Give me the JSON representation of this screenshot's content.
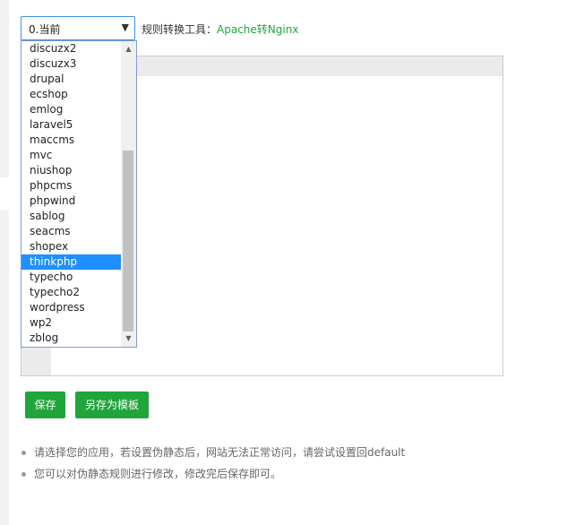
{
  "select": {
    "value": "0.当前"
  },
  "tool": {
    "label": "规则转换工具：",
    "link": "Apache转Nginx"
  },
  "dropdown": {
    "options": [
      "discuzx2",
      "discuzx3",
      "drupal",
      "ecshop",
      "emlog",
      "laravel5",
      "maccms",
      "mvc",
      "niushop",
      "phpcms",
      "phpwind",
      "sablog",
      "seacms",
      "shopex",
      "thinkphp",
      "typecho",
      "typecho2",
      "wordpress",
      "wp2",
      "zblog"
    ],
    "selected": "thinkphp"
  },
  "buttons": {
    "save": "保存",
    "save_as": "另存为模板"
  },
  "tips": [
    "请选择您的应用，若设置伪静态后，网站无法正常访问，请尝试设置回default",
    "您可以对伪静态规则进行修改，修改完后保存即可。"
  ],
  "colors": {
    "accent": "#20a53a",
    "selected_bg": "#1e90ff",
    "focus_border": "#3d8fe6"
  }
}
